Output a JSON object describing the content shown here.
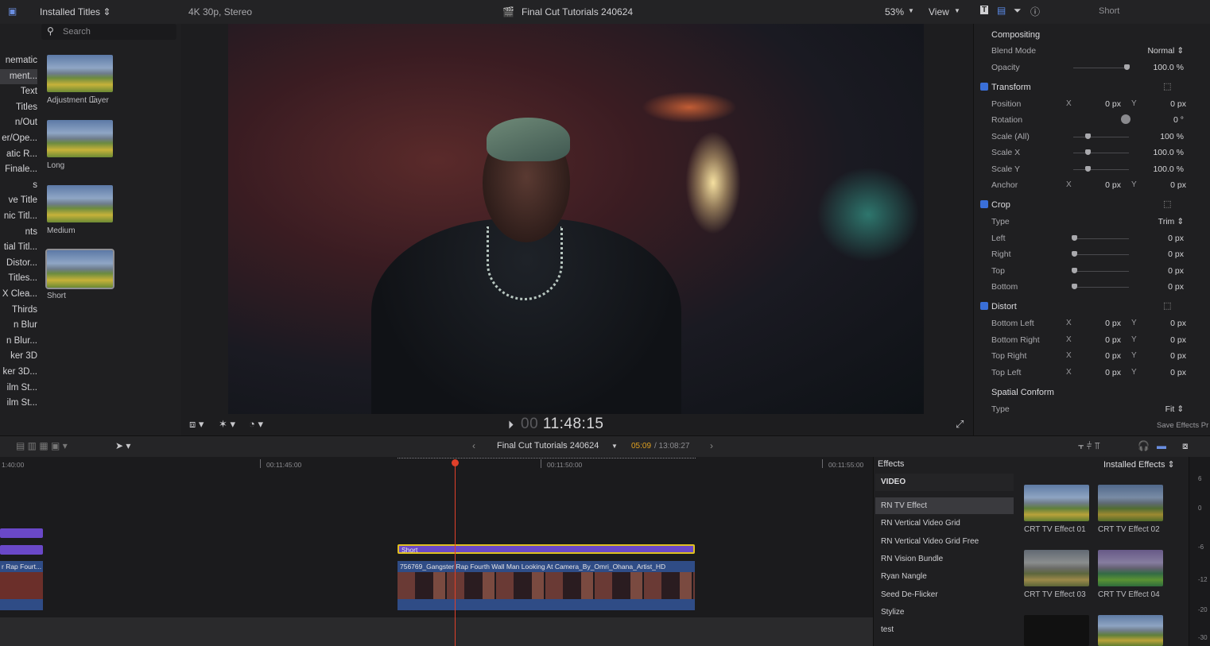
{
  "topbar": {
    "browser_title": "Installed Titles ⇕",
    "format": "4K 30p, Stereo",
    "project": "Final Cut Tutorials 240624",
    "zoom": "53%",
    "view": "View",
    "inspector_name": "Short"
  },
  "browser": {
    "search_placeholder": "Search",
    "categories": [
      "nematic",
      "ment...",
      "Text",
      "Titles",
      "n/Out",
      "er/Ope...",
      "atic R...",
      "Finale...",
      "s",
      "ve Title",
      "nic Titl...",
      "nts",
      "tial Titl...",
      "Distor...",
      "Titles...",
      "X Clea...",
      "Thirds",
      "n Blur",
      "n Blur...",
      "ker 3D",
      "ker 3D...",
      "ilm St...",
      "ilm St..."
    ],
    "thumbs": [
      {
        "label": "Adjustment Layer"
      },
      {
        "label": "Long"
      },
      {
        "label": "Medium"
      },
      {
        "label": "Short"
      }
    ]
  },
  "viewer": {
    "timecode": "11:48:15",
    "timecode_prefix": "00"
  },
  "inspector": {
    "compositing": "Compositing",
    "blend_mode_label": "Blend Mode",
    "blend_mode_value": "Normal ⇕",
    "opacity_label": "Opacity",
    "opacity_value": "100.0 %",
    "transform": "Transform",
    "position_label": "Position",
    "position_x": "0 px",
    "position_y": "0 px",
    "rotation_label": "Rotation",
    "rotation_value": "0 °",
    "scale_all_label": "Scale (All)",
    "scale_all_value": "100 %",
    "scale_x_label": "Scale X",
    "scale_x_value": "100.0 %",
    "scale_y_label": "Scale Y",
    "scale_y_value": "100.0 %",
    "anchor_label": "Anchor",
    "anchor_x": "0 px",
    "anchor_y": "0 px",
    "crop": "Crop",
    "crop_type_label": "Type",
    "crop_type_value": "Trim ⇕",
    "left_label": "Left",
    "left_value": "0 px",
    "right_label": "Right",
    "right_value": "0 px",
    "top_label": "Top",
    "top_value": "0 px",
    "bottom_label": "Bottom",
    "bottom_value": "0 px",
    "distort": "Distort",
    "bl_label": "Bottom Left",
    "bl_x": "0 px",
    "bl_y": "0 px",
    "br_label": "Bottom Right",
    "br_x": "0 px",
    "br_y": "0 px",
    "tr_label": "Top Right",
    "tr_x": "0 px",
    "tr_y": "0 px",
    "tl_label": "Top Left",
    "tl_x": "0 px",
    "tl_y": "0 px",
    "spatial": "Spatial Conform",
    "spatial_type_label": "Type",
    "spatial_type_value": "Fit ⇕",
    "save_effects": "Save Effects Pr",
    "axis_x": "X",
    "axis_y": "Y"
  },
  "timeline_bar": {
    "project": "Final Cut Tutorials 240624",
    "position": "05:09",
    "duration": "/ 13:08:27"
  },
  "timeline": {
    "ruler": [
      "1:40:00",
      "00:11:45:00",
      "00:11:50:00",
      "00:11:55:00"
    ],
    "title_clip": "Short",
    "video_clip": "756769_Gangster Rap Fourth Wall Man Looking At Camera_By_Omri_Ohana_Artist_HD",
    "left_clip": "r Rap Fourt..."
  },
  "effects": {
    "header": "Effects",
    "installed": "Installed Effects ⇕",
    "section": "VIDEO",
    "items": [
      "RN TV Effect",
      "RN Vertical Video Grid",
      "RN Vertical Video Grid Free",
      "RN Vision Bundle",
      "Ryan Nangle",
      "Seed De-Flicker",
      "Stylize",
      "test"
    ],
    "thumbs": [
      "CRT TV Effect 01",
      "CRT TV Effect 02",
      "CRT TV Effect 03",
      "CRT TV Effect 04"
    ]
  },
  "meter": {
    "marks": [
      "6",
      "0",
      "-6",
      "-12",
      "-20",
      "-30"
    ]
  }
}
